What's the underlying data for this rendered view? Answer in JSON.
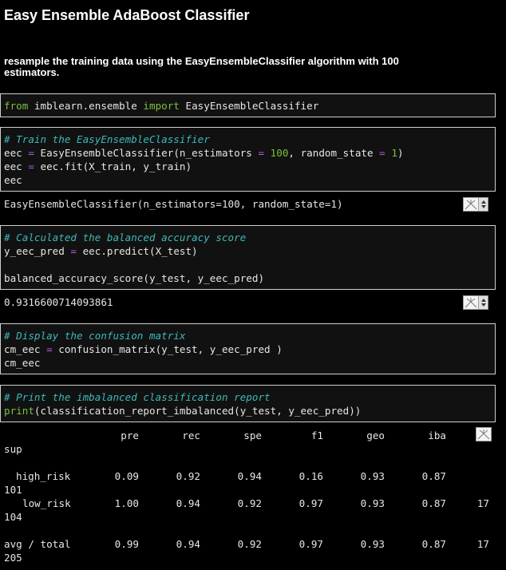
{
  "heading": "Easy Ensemble AdaBoost Classifier",
  "description": "resample the training data using the EasyEnsembleClassifier algorithm with 100 estimators.",
  "cells": {
    "import": {
      "kw_from": "from",
      "module": " imblearn.ensemble ",
      "kw_import": "import",
      "name": " EasyEnsembleClassifier"
    },
    "train": {
      "comment": "# Train the EasyEnsembleClassifier",
      "line2_a": "eec ",
      "line2_op": "=",
      "line2_b": " EasyEnsembleClassifier(n_estimators ",
      "line2_op2": "=",
      "line2_sp": " ",
      "line2_num": "100",
      "line2_c": ", random_state ",
      "line2_op3": "=",
      "line2_sp2": " ",
      "line2_num2": "1",
      "line2_d": ")",
      "line3_a": "eec ",
      "line3_op": "=",
      "line3_b": " eec.fit(X_train, y_train)",
      "line4": "eec",
      "output": "EasyEnsembleClassifier(n_estimators=100, random_state=1)"
    },
    "accuracy": {
      "comment": "# Calculated the balanced accuracy score",
      "line2_a": "y_eec_pred ",
      "line2_op": "=",
      "line2_b": " eec.predict(X_test)",
      "line4": "balanced_accuracy_score(y_test, y_eec_pred)",
      "output": "0.9316600714093861"
    },
    "confusion": {
      "comment": "# Display the confusion matrix",
      "line2_a": "cm_eec ",
      "line2_op": "=",
      "line2_b": " confusion_matrix(y_test, y_eec_pred )",
      "line3": "cm_eec"
    },
    "report": {
      "comment": "# Print the imbalanced classification report",
      "fn": "print",
      "rest": "(classification_report_imbalanced(y_test, y_eec_pred))"
    }
  },
  "report_table": {
    "headers": [
      "pre",
      "rec",
      "spe",
      "f1",
      "geo",
      "iba",
      "sup"
    ],
    "rows": [
      {
        "label": "high_risk",
        "values": [
          "0.09",
          "0.92",
          "0.94",
          "0.16",
          "0.93",
          "0.87"
        ],
        "trail": "",
        "sup": "101"
      },
      {
        "label": "low_risk",
        "values": [
          "1.00",
          "0.94",
          "0.92",
          "0.97",
          "0.93",
          "0.87"
        ],
        "trail": "17",
        "sup": "104"
      },
      {
        "label": "avg / total",
        "values": [
          "0.99",
          "0.94",
          "0.92",
          "0.97",
          "0.93",
          "0.87"
        ],
        "trail": "17",
        "sup": "205"
      }
    ]
  },
  "icons": {
    "output_toggle": "scroll-expand-icon",
    "spinner": "spinner-arrows-icon"
  }
}
